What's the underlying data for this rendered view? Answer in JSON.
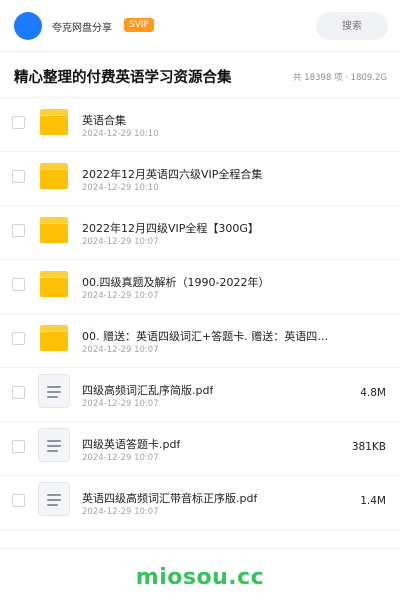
{
  "header": {
    "sharer_name": "夸克网盘分享",
    "badge": "SVIP",
    "search_placeholder": "搜索"
  },
  "share": {
    "title": "精心整理的付费英语学习资源合集",
    "stats": "共 18398 项 · 1809.2G"
  },
  "items": [
    {
      "type": "folder",
      "name": "英语合集",
      "date": "2024-12-29 10:10",
      "size": ""
    },
    {
      "type": "folder",
      "name": "2022年12月英语四六级VIP全程合集",
      "date": "2024-12-29 10:10",
      "size": ""
    },
    {
      "type": "folder",
      "name": "2022年12月四级VIP全程【300G】",
      "date": "2024-12-29 10:07",
      "size": ""
    },
    {
      "type": "folder",
      "name": "00.四级真题及解析（1990-2022年）",
      "date": "2024-12-29 10:07",
      "size": ""
    },
    {
      "type": "folder",
      "name": "00. 赠送：英语四级词汇+答题卡. 赠送：英语四…",
      "date": "2024-12-29 10:07",
      "size": ""
    },
    {
      "type": "file",
      "name": "四级高频词汇乱序简版.pdf",
      "date": "2024-12-29 10:07",
      "size": "4.8M"
    },
    {
      "type": "file",
      "name": "四级英语答题卡.pdf",
      "date": "2024-12-29 10:07",
      "size": "381KB"
    },
    {
      "type": "file",
      "name": "英语四级高频词汇带音标正序版.pdf",
      "date": "2024-12-29 10:07",
      "size": "1.4M"
    }
  ],
  "footer": {
    "brand": "miosou.cc"
  },
  "colors": {
    "accent_blue": "#1e7bff",
    "svip_orange": "#ff9a1f",
    "folder_yellow": "#ffc107",
    "brand_green": "#38c25e"
  },
  "icons": {
    "folder": "folder-icon",
    "file": "document-icon"
  }
}
